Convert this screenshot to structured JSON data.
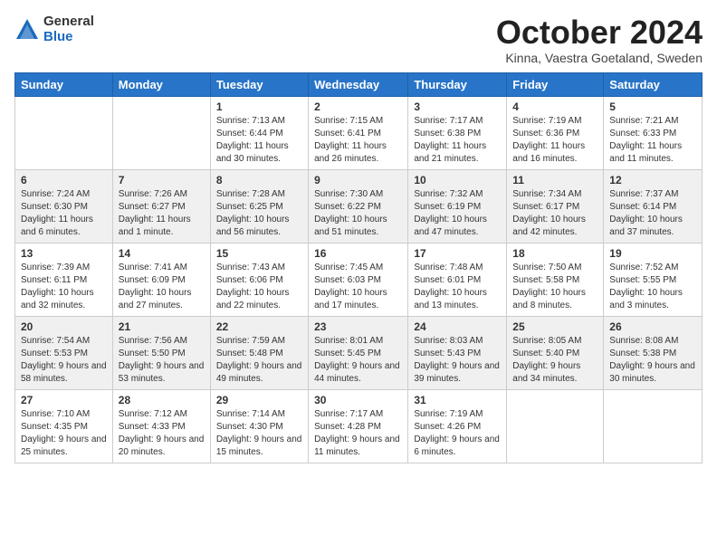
{
  "logo": {
    "general": "General",
    "blue": "Blue"
  },
  "title": "October 2024",
  "subtitle": "Kinna, Vaestra Goetaland, Sweden",
  "headers": [
    "Sunday",
    "Monday",
    "Tuesday",
    "Wednesday",
    "Thursday",
    "Friday",
    "Saturday"
  ],
  "weeks": [
    [
      {
        "day": "",
        "info": ""
      },
      {
        "day": "",
        "info": ""
      },
      {
        "day": "1",
        "info": "Sunrise: 7:13 AM\nSunset: 6:44 PM\nDaylight: 11 hours and 30 minutes."
      },
      {
        "day": "2",
        "info": "Sunrise: 7:15 AM\nSunset: 6:41 PM\nDaylight: 11 hours and 26 minutes."
      },
      {
        "day": "3",
        "info": "Sunrise: 7:17 AM\nSunset: 6:38 PM\nDaylight: 11 hours and 21 minutes."
      },
      {
        "day": "4",
        "info": "Sunrise: 7:19 AM\nSunset: 6:36 PM\nDaylight: 11 hours and 16 minutes."
      },
      {
        "day": "5",
        "info": "Sunrise: 7:21 AM\nSunset: 6:33 PM\nDaylight: 11 hours and 11 minutes."
      }
    ],
    [
      {
        "day": "6",
        "info": "Sunrise: 7:24 AM\nSunset: 6:30 PM\nDaylight: 11 hours and 6 minutes."
      },
      {
        "day": "7",
        "info": "Sunrise: 7:26 AM\nSunset: 6:27 PM\nDaylight: 11 hours and 1 minute."
      },
      {
        "day": "8",
        "info": "Sunrise: 7:28 AM\nSunset: 6:25 PM\nDaylight: 10 hours and 56 minutes."
      },
      {
        "day": "9",
        "info": "Sunrise: 7:30 AM\nSunset: 6:22 PM\nDaylight: 10 hours and 51 minutes."
      },
      {
        "day": "10",
        "info": "Sunrise: 7:32 AM\nSunset: 6:19 PM\nDaylight: 10 hours and 47 minutes."
      },
      {
        "day": "11",
        "info": "Sunrise: 7:34 AM\nSunset: 6:17 PM\nDaylight: 10 hours and 42 minutes."
      },
      {
        "day": "12",
        "info": "Sunrise: 7:37 AM\nSunset: 6:14 PM\nDaylight: 10 hours and 37 minutes."
      }
    ],
    [
      {
        "day": "13",
        "info": "Sunrise: 7:39 AM\nSunset: 6:11 PM\nDaylight: 10 hours and 32 minutes."
      },
      {
        "day": "14",
        "info": "Sunrise: 7:41 AM\nSunset: 6:09 PM\nDaylight: 10 hours and 27 minutes."
      },
      {
        "day": "15",
        "info": "Sunrise: 7:43 AM\nSunset: 6:06 PM\nDaylight: 10 hours and 22 minutes."
      },
      {
        "day": "16",
        "info": "Sunrise: 7:45 AM\nSunset: 6:03 PM\nDaylight: 10 hours and 17 minutes."
      },
      {
        "day": "17",
        "info": "Sunrise: 7:48 AM\nSunset: 6:01 PM\nDaylight: 10 hours and 13 minutes."
      },
      {
        "day": "18",
        "info": "Sunrise: 7:50 AM\nSunset: 5:58 PM\nDaylight: 10 hours and 8 minutes."
      },
      {
        "day": "19",
        "info": "Sunrise: 7:52 AM\nSunset: 5:55 PM\nDaylight: 10 hours and 3 minutes."
      }
    ],
    [
      {
        "day": "20",
        "info": "Sunrise: 7:54 AM\nSunset: 5:53 PM\nDaylight: 9 hours and 58 minutes."
      },
      {
        "day": "21",
        "info": "Sunrise: 7:56 AM\nSunset: 5:50 PM\nDaylight: 9 hours and 53 minutes."
      },
      {
        "day": "22",
        "info": "Sunrise: 7:59 AM\nSunset: 5:48 PM\nDaylight: 9 hours and 49 minutes."
      },
      {
        "day": "23",
        "info": "Sunrise: 8:01 AM\nSunset: 5:45 PM\nDaylight: 9 hours and 44 minutes."
      },
      {
        "day": "24",
        "info": "Sunrise: 8:03 AM\nSunset: 5:43 PM\nDaylight: 9 hours and 39 minutes."
      },
      {
        "day": "25",
        "info": "Sunrise: 8:05 AM\nSunset: 5:40 PM\nDaylight: 9 hours and 34 minutes."
      },
      {
        "day": "26",
        "info": "Sunrise: 8:08 AM\nSunset: 5:38 PM\nDaylight: 9 hours and 30 minutes."
      }
    ],
    [
      {
        "day": "27",
        "info": "Sunrise: 7:10 AM\nSunset: 4:35 PM\nDaylight: 9 hours and 25 minutes."
      },
      {
        "day": "28",
        "info": "Sunrise: 7:12 AM\nSunset: 4:33 PM\nDaylight: 9 hours and 20 minutes."
      },
      {
        "day": "29",
        "info": "Sunrise: 7:14 AM\nSunset: 4:30 PM\nDaylight: 9 hours and 15 minutes."
      },
      {
        "day": "30",
        "info": "Sunrise: 7:17 AM\nSunset: 4:28 PM\nDaylight: 9 hours and 11 minutes."
      },
      {
        "day": "31",
        "info": "Sunrise: 7:19 AM\nSunset: 4:26 PM\nDaylight: 9 hours and 6 minutes."
      },
      {
        "day": "",
        "info": ""
      },
      {
        "day": "",
        "info": ""
      }
    ]
  ]
}
